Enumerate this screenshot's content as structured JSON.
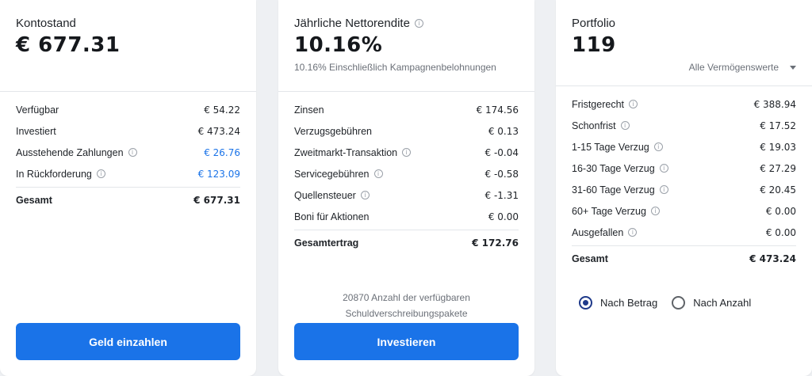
{
  "balance": {
    "title": "Kontostand",
    "value": "€ 677.31",
    "rows": [
      {
        "label": "Verfügbar",
        "value": "€ 54.22"
      },
      {
        "label": "Investiert",
        "value": "€ 473.24"
      },
      {
        "label": "Ausstehende Zahlungen",
        "value": "€ 26.76"
      },
      {
        "label": "In Rückforderung",
        "value": "€ 123.09"
      }
    ],
    "total_label": "Gesamt",
    "total_value": "€ 677.31",
    "button": "Geld einzahlen"
  },
  "return": {
    "title": "Jährliche Nettorendite",
    "value": "10.16%",
    "note": "10.16% Einschließlich Kampagnenbelohnungen",
    "rows": [
      {
        "label": "Zinsen",
        "value": "€ 174.56"
      },
      {
        "label": "Verzugsgebühren",
        "value": "€ 0.13"
      },
      {
        "label": "Zweitmarkt-Transaktion",
        "value": "€ -0.04"
      },
      {
        "label": "Servicegebühren",
        "value": "€ -0.58"
      },
      {
        "label": "Quellensteuer",
        "value": "€ -1.31"
      },
      {
        "label": "Boni für Aktionen",
        "value": "€ 0.00"
      }
    ],
    "total_label": "Gesamtertrag",
    "total_value": "€ 172.76",
    "package_line1": "20870 Anzahl der verfügbaren",
    "package_line2": "Schuldverschreibungspakete",
    "button": "Investieren"
  },
  "portfolio": {
    "title": "Portfolio",
    "value": "119",
    "selector": "Alle Vermögenswerte",
    "rows": [
      {
        "label": "Fristgerecht",
        "value": "€ 388.94"
      },
      {
        "label": "Schonfrist",
        "value": "€ 17.52"
      },
      {
        "label": "1-15 Tage Verzug",
        "value": "€ 19.03"
      },
      {
        "label": "16-30 Tage Verzug",
        "value": "€ 27.29"
      },
      {
        "label": "31-60 Tage Verzug",
        "value": "€ 20.45"
      },
      {
        "label": "60+ Tage Verzug",
        "value": "€ 0.00"
      },
      {
        "label": "Ausgefallen",
        "value": "€ 0.00"
      }
    ],
    "total_label": "Gesamt",
    "total_value": "€ 473.24",
    "radio_amount": "Nach Betrag",
    "radio_count": "Nach Anzahl",
    "radio_selected": "Nach Betrag"
  },
  "colors": {
    "accent": "#1a73e8",
    "radio_checked": "#1f3a8a"
  }
}
